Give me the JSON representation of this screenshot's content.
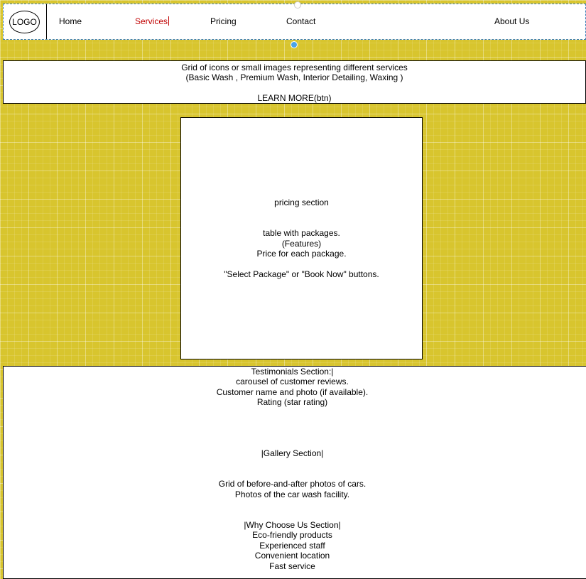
{
  "nav": {
    "logo": "LOGO",
    "items": [
      "Home",
      "Services",
      "Pricing",
      "Contact",
      "About Us"
    ]
  },
  "services_section": {
    "lines": [
      "Grid of icons or small images representing different services",
      "(Basic Wash , Premium Wash, Interior Detailing, Waxing )",
      "",
      "LEARN MORE(btn)"
    ]
  },
  "pricing_section": {
    "lines": [
      "pricing section",
      "",
      "",
      "table with packages.",
      "(Features)",
      "Price for each package.",
      "",
      "\"Select Package\" or \"Book Now\" buttons."
    ]
  },
  "testimonials_section": {
    "lines": [
      "Testimonials Section:|",
      "carousel of customer reviews.",
      "Customer name and photo (if available).",
      "Rating (star rating)",
      "",
      "",
      "",
      "",
      "|Gallery Section|",
      "",
      "",
      "Grid of before-and-after photos of cars.",
      "Photos of the car wash facility.",
      "",
      "",
      "|Why Choose Us Section|",
      "Eco-friendly products",
      "Experienced staff",
      "Convenient location",
      "Fast service"
    ]
  },
  "colors": {
    "canvas_bg": "#d8c52e",
    "active_nav": "#c00000",
    "selection_handle": "#4aa3e8"
  }
}
